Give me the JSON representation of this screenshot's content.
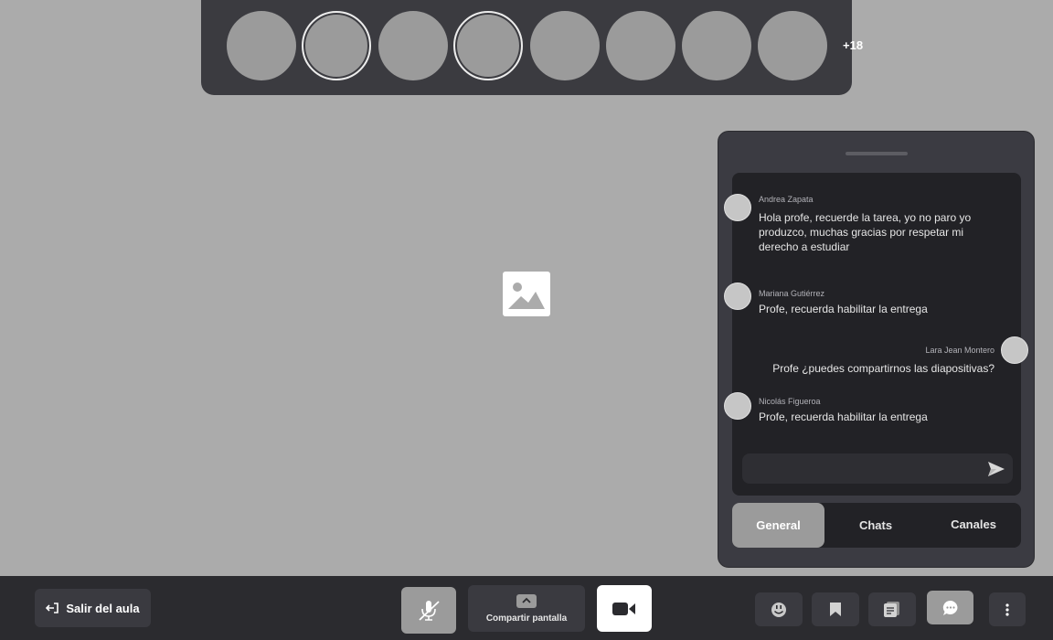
{
  "participants": {
    "overflow_count": "+18"
  },
  "chat": {
    "messages": [
      {
        "name": "Andrea Zapata",
        "text": "Hola profe, recuerde la tarea, yo no paro yo produzco, muchas gracias por respetar mi derecho a estudiar"
      },
      {
        "name": "Mariana Gutiérrez",
        "text": "Profe, recuerda habilitar la entrega"
      },
      {
        "name": "Lara Jean Montero",
        "text": "Profe ¿puedes compartirnos las diapositivas?"
      },
      {
        "name": "Nicolás Figueroa",
        "text": "Profe, recuerda habilitar la entrega"
      }
    ],
    "input_placeholder": "",
    "tabs": [
      {
        "label": "General",
        "active": true
      },
      {
        "label": "Chats",
        "active": false
      },
      {
        "label": "Canales",
        "active": false
      }
    ]
  },
  "toolbar": {
    "leave_label": "Salir del aula",
    "share_label": "Compartir pantalla"
  },
  "icons": {
    "leave": "exit-icon",
    "mic": "mic-off-icon",
    "share": "screen-share-icon",
    "camera": "video-camera-icon",
    "emoji": "emoji-icon",
    "bookmark": "bookmark-icon",
    "notes": "notes-icon",
    "chat": "chat-bubble-icon",
    "more": "more-vertical-icon",
    "send": "send-icon",
    "image": "image-placeholder-icon"
  },
  "colors": {
    "background": "#ababab",
    "panel": "#3b3b42",
    "bar": "#2b2b2f",
    "active": "#9b9b9b"
  }
}
